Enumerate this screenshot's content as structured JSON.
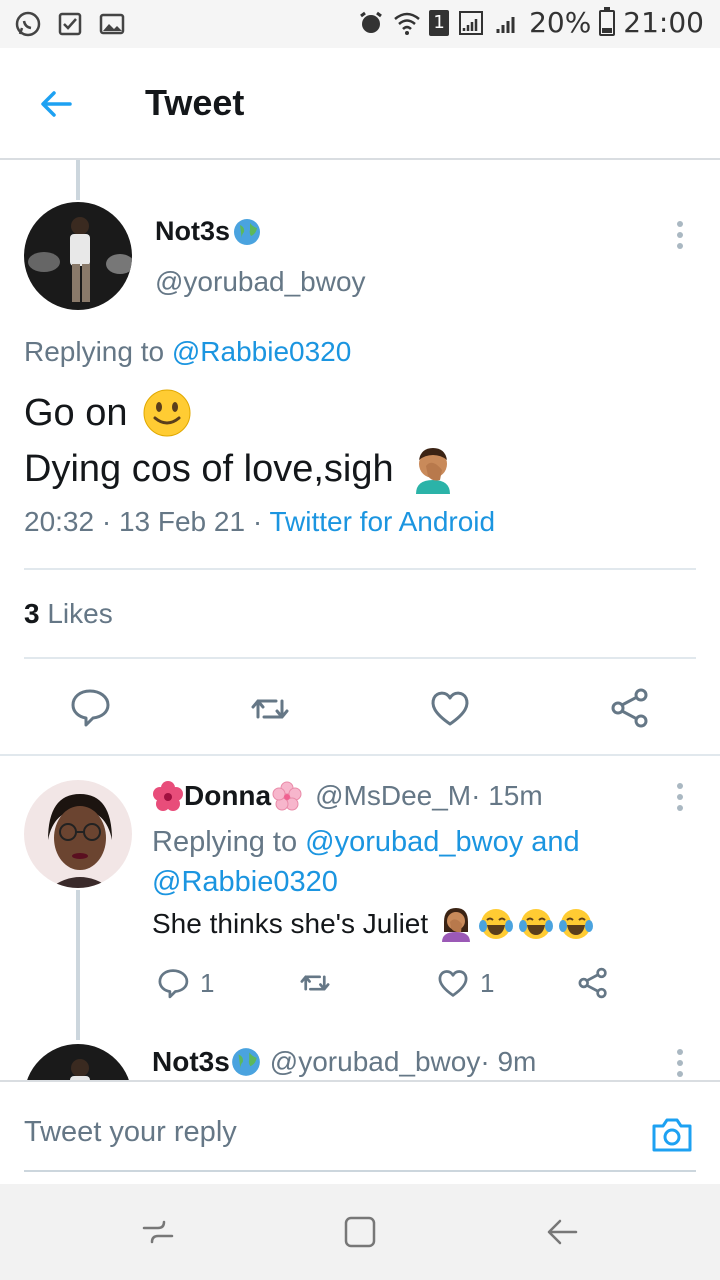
{
  "status_bar": {
    "battery_text": "20%",
    "battery_level": 0.2,
    "time": "21:00",
    "sim_badge": "1"
  },
  "header": {
    "title": "Tweet"
  },
  "tweet": {
    "author_name": "Not3s",
    "author_handle": "@yorubad_bwoy",
    "replying_prefix": "Replying to ",
    "replying_to": "@Rabbie0320",
    "line1": "Go on",
    "line2": "Dying cos of love,sigh",
    "time_date": "20:32 · 13 Feb 21 · ",
    "source": "Twitter for Android",
    "likes_count": "3",
    "likes_label": " Likes"
  },
  "reply": {
    "author_name": "Donna",
    "author_handle": "@MsDee_M",
    "age": " · 15m",
    "replying_prefix": "Replying to ",
    "replying_to": "@yorubad_bwoy and @Rabbie0320",
    "text": "She thinks she's Juliet",
    "reply_count": "1",
    "like_count": "1"
  },
  "next_reply": {
    "author_name": "Not3s",
    "author_handle": "@yorubad_bwoy",
    "age": " · 9m"
  },
  "compose": {
    "placeholder": "Tweet your reply"
  },
  "colors": {
    "accent": "#1da1f2",
    "link": "#1b95e0",
    "secondary_text": "#657786",
    "primary_text": "#14171a",
    "divider": "#e1e8ed"
  }
}
